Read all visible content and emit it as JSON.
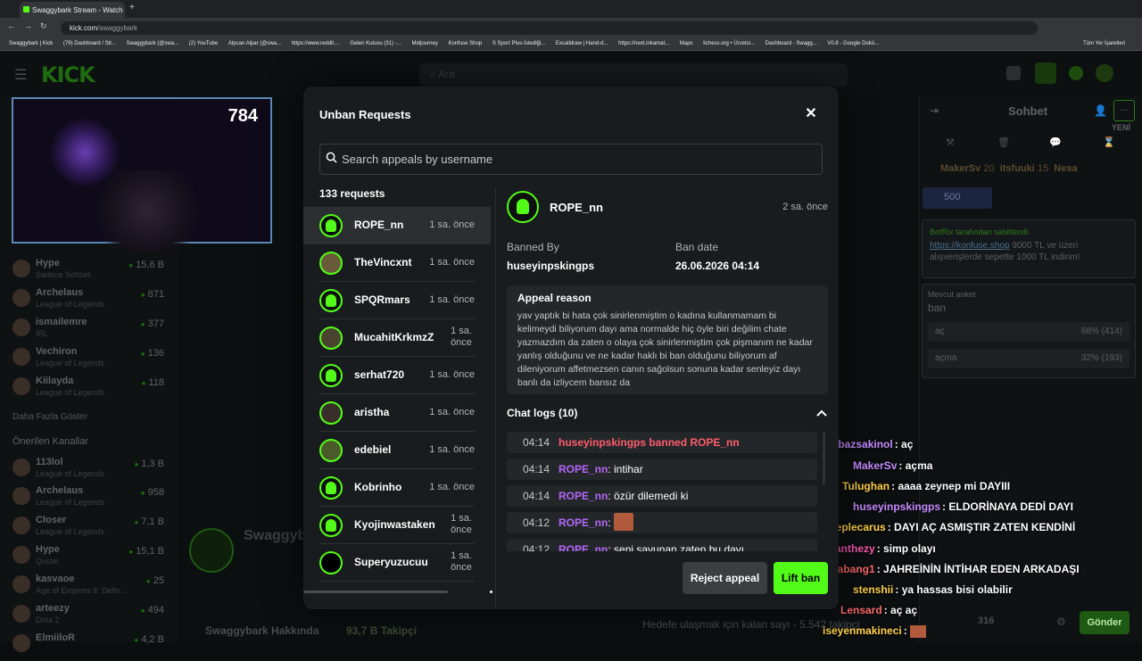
{
  "browser": {
    "tab_title": "Swaggybark Stream - Watch Liv",
    "url": "kick.com/swaggybark",
    "url_domain": "kick.com",
    "url_path": "/swaggybark",
    "bookmarks": [
      "Swaggybark | Kick",
      "(79) Dashboard / Str...",
      "Swaggybark (@swa...",
      "(2) YouTube",
      "Alpcan Alpar (@swa...",
      "https://www.reddit....",
      "Gelen Kutusu (31) -...",
      "Midjourney",
      "Konfuse Shop",
      "S Sport Plus-İstediği...",
      "Excalidraw | Hand-d...",
      "https://next.inkamat...",
      "Maps",
      "lichess.org • Ücretsi...",
      "Dashboard - Swagg...",
      "V0.8 - Google Dokü..."
    ],
    "bookmarks_other": "Tüm Yer İşaretleri"
  },
  "kick": {
    "search_placeholder": "Ara",
    "viewer_count": "784",
    "sidebar_following": [
      {
        "name": "Hype",
        "category": "Sadece Sohbet",
        "viewers": "15,6 B"
      },
      {
        "name": "Archelaus",
        "category": "League of Legends",
        "viewers": "871"
      },
      {
        "name": "ismailemre",
        "category": "IRL",
        "viewers": "377"
      },
      {
        "name": "Vechiron",
        "category": "League of Legends",
        "viewers": "136"
      },
      {
        "name": "Kiilayda",
        "category": "League of Legends",
        "viewers": "118"
      }
    ],
    "show_more": "Daha Fazla Göster",
    "recommended_heading": "Önerilen Kanallar",
    "sidebar_recommended": [
      {
        "name": "113lol",
        "category": "League of Legends",
        "viewers": "1,3 B"
      },
      {
        "name": "Archelaus",
        "category": "League of Legends",
        "viewers": "958"
      },
      {
        "name": "Closer",
        "category": "League of Legends",
        "viewers": "7,1 B"
      },
      {
        "name": "Hype",
        "category": "Quizei",
        "viewers": "15,1 B"
      },
      {
        "name": "kasvaoe",
        "category": "Age of Empires II: Defin...",
        "viewers": "25"
      },
      {
        "name": "arteezy",
        "category": "Dota 2",
        "viewers": "494"
      },
      {
        "name": "ElmiiloR",
        "category": "",
        "viewers": "4,2 B"
      }
    ],
    "channel_name": "Swaggybark",
    "about": "Swaggybark Hakkında",
    "followers": "93,7 B Takipçi",
    "goal_text": "Hedefe ulaşmak için kalan sayı - 5.542 takipçi",
    "chat_title": "Sohbet",
    "leaderboard": [
      {
        "name": "MakerSv",
        "val": "20"
      },
      {
        "name": "itsfuuki",
        "val": "15"
      },
      {
        "name": "Nesa",
        "val": ""
      }
    ],
    "gift_count": "500",
    "pinned_by": "BotRix tarafından sabitlendi",
    "pinned_link": "https://konfuse.shop",
    "pinned_text": "9000 TL ve üzeri alışverişlerde sepette 1000 TL indirim!",
    "poll_label": "Mevcut anket",
    "poll_title": "ban",
    "poll_options": [
      {
        "label": "aç",
        "value": "68% (414)"
      },
      {
        "label": "açma",
        "value": "32% (193)"
      }
    ],
    "chat_count": "316",
    "send_label": "Gönder",
    "new_label": "YENİ"
  },
  "chat_overlay": [
    {
      "user": "ambazsakinol",
      "color": "#c68cff",
      "text": "aç"
    },
    {
      "user": "MakerSv",
      "color": "#c68cff",
      "text": "açma"
    },
    {
      "user": "Tulughan",
      "color": "#ffd24a",
      "text": "aaaa zeynep mi DAYIII"
    },
    {
      "user": "huseyinpskingps",
      "color": "#c68cff",
      "text": "ELDORİNAYA DEDİ DAYI"
    },
    {
      "user": "Neplecarus",
      "color": "#ffd24a",
      "text": "DAYI AÇ ASMIŞTIR ZATEN KENDİNİ"
    },
    {
      "user": "Panthezy",
      "color": "#ff5cb6",
      "text": "simp olayı"
    },
    {
      "user": "atabang1",
      "color": "#ff6b6b",
      "text": "JAHREİNİN İNTİHAR EDEN ARKADAŞI"
    },
    {
      "user": "stenshii",
      "color": "#ffd24a",
      "text": "ya hassas bisi olabilir"
    },
    {
      "user": "Lensard",
      "color": "#ff6b6b",
      "text": "aç aç"
    },
    {
      "user": "iseyenmakineci",
      "color": "#ffd24a",
      "text": ""
    }
  ],
  "modal": {
    "title": "Unban Requests",
    "search_placeholder": "Search appeals by username",
    "request_count": "133 requests",
    "requests": [
      {
        "name": "ROPE_nn",
        "time": "1 sa. önce"
      },
      {
        "name": "TheVincxnt",
        "time": "1 sa. önce"
      },
      {
        "name": "SPQRmars",
        "time": "1 sa. önce"
      },
      {
        "name": "MucahitKrkmzZ",
        "time": "1 sa. önce"
      },
      {
        "name": "serhat720",
        "time": "1 sa. önce"
      },
      {
        "name": "aristha",
        "time": "1 sa. önce"
      },
      {
        "name": "edebiel",
        "time": "1 sa. önce"
      },
      {
        "name": "Kobrinho",
        "time": "1 sa. önce"
      },
      {
        "name": "Kyojinwastaken",
        "time": "1 sa. önce"
      },
      {
        "name": "Superyuzucuu",
        "time": "1 sa. önce"
      }
    ],
    "detail": {
      "username": "ROPE_nn",
      "time": "2 sa. önce",
      "banned_by_label": "Banned By",
      "banned_by": "huseyinpskingps",
      "ban_date_label": "Ban date",
      "ban_date": "26.06.2026 04:14",
      "appeal_title": "Appeal reason",
      "appeal_text": "yav yaptık bi hata çok sinirlenmiştim o kadına kullanmamam bi kelimeydi biliyorum dayı ama normalde hiç öyle biri değilim chate yazmazdım da zaten o olaya çok sinirlenmiştim çok pişmanım ne kadar yanlış olduğunu ve ne kadar haklı bi ban olduğunu biliyorum af dileniyorum affetmezsen canın sağolsun sonuna kadar senleyiz dayı banlı da izliycem bansız da",
      "chat_logs_title": "Chat logs (10)",
      "logs": [
        {
          "time": "04:14",
          "user": "huseyinpskingps banned ROPE_nn",
          "text": "",
          "type": "ban"
        },
        {
          "time": "04:14",
          "user": "ROPE_nn",
          "text": "intihar",
          "type": "msg"
        },
        {
          "time": "04:14",
          "user": "ROPE_nn",
          "text": "özür dilemedi ki",
          "type": "msg"
        },
        {
          "time": "04:12",
          "user": "ROPE_nn",
          "text": "",
          "type": "emote"
        },
        {
          "time": "04:12",
          "user": "ROPE_nn",
          "text": "seni savunan zaten bu dayı",
          "type": "msg"
        }
      ]
    },
    "reject_label": "Reject appeal",
    "liftban_label": "Lift ban"
  }
}
